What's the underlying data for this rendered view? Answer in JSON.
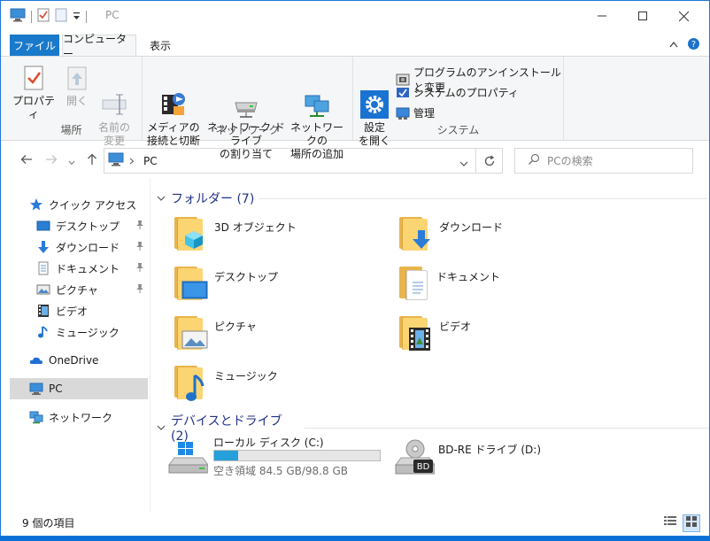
{
  "window": {
    "title": "PC"
  },
  "ribbon": {
    "tabs": {
      "file": "ファイル",
      "computer": "コンピューター",
      "view": "表示"
    },
    "groups": {
      "location": {
        "label": "場所",
        "properties": "プロパティ",
        "open": "開く",
        "rename": "名前の\n変更"
      },
      "network": {
        "label": "ネットワーク",
        "media": "メディアの\n接続と切断",
        "map_drive": "ネットワーク ドライブ\nの割り当て",
        "add_location": "ネットワークの\n場所の追加"
      },
      "system": {
        "label": "システム",
        "settings": "設定\nを開く",
        "uninstall": "プログラムのアンインストールと変更",
        "system_props": "システムのプロパティ",
        "manage": "管理"
      }
    }
  },
  "address": {
    "path": "PC",
    "search_placeholder": "PCの検索"
  },
  "nav": {
    "quick_access": "クイック アクセス",
    "items": [
      {
        "label": "デスクトップ",
        "pinned": true
      },
      {
        "label": "ダウンロード",
        "pinned": true
      },
      {
        "label": "ドキュメント",
        "pinned": true
      },
      {
        "label": "ピクチャ",
        "pinned": true
      },
      {
        "label": "ビデオ",
        "pinned": false
      },
      {
        "label": "ミュージック",
        "pinned": false
      }
    ],
    "onedrive": "OneDrive",
    "pc": "PC",
    "network": "ネットワーク"
  },
  "content": {
    "folders_header": "フォルダー (7)",
    "folders": [
      "3D オブジェクト",
      "ダウンロード",
      "デスクトップ",
      "ドキュメント",
      "ピクチャ",
      "ビデオ",
      "ミュージック"
    ],
    "drives_header": "デバイスとドライブ (2)",
    "drives": {
      "local": {
        "label": "ローカル ディスク (C:)",
        "free_text": "空き領域 84.5 GB/98.8 GB",
        "used_fraction": 0.145
      },
      "bd": {
        "label": "BD-RE ドライブ (D:)",
        "badge": "BD"
      }
    }
  },
  "status": {
    "items": "9 個の項目"
  },
  "colors": {
    "accent": "#1979ca",
    "drive_fill": "#26a0da",
    "folder_header": "#1e3287"
  }
}
